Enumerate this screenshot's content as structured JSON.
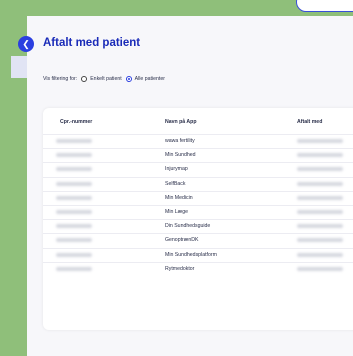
{
  "page": {
    "title": "Aftalt med patient"
  },
  "filter": {
    "label": "Vis filtering for:",
    "options": [
      {
        "label": "Enkelt patient",
        "selected": false
      },
      {
        "label": "Alle patienter",
        "selected": true
      }
    ]
  },
  "table": {
    "headers": [
      "Cpr.-nummer",
      "Navn på App",
      "Aftalt med"
    ],
    "rows": [
      {
        "app": "wawa fertility"
      },
      {
        "app": "Min Sundhed"
      },
      {
        "app": "Injurymap"
      },
      {
        "app": "SelfBack"
      },
      {
        "app": "Min Medicin"
      },
      {
        "app": "Min Læge"
      },
      {
        "app": "Din Sundhedsguide"
      },
      {
        "app": "GenoptrænDK"
      },
      {
        "app": "Min Sundhedsplatform"
      },
      {
        "app": "Rytmedoktor"
      }
    ]
  },
  "colors": {
    "accent": "#2b3fe0",
    "title": "#1a2bb8",
    "background": "#8fbf7a"
  }
}
